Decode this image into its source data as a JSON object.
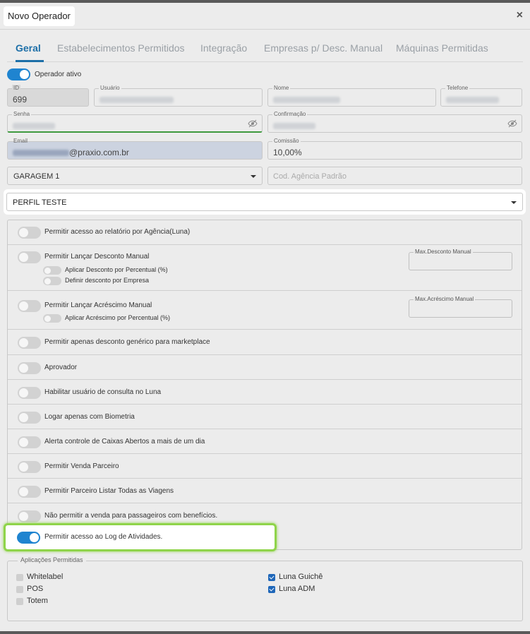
{
  "modal": {
    "title": "Novo Operador",
    "close_label": "×"
  },
  "tabs": [
    {
      "label": "Geral",
      "active": true
    },
    {
      "label": "Estabelecimentos Permitidos",
      "active": false
    },
    {
      "label": "Integração",
      "active": false
    },
    {
      "label": "Empresas p/ Desc. Manual",
      "active": false
    },
    {
      "label": "Máquinas Permitidas",
      "active": false
    }
  ],
  "operator_active": {
    "label": "Operador ativo",
    "on": true
  },
  "fields": {
    "id": {
      "label": "ID",
      "value": "699"
    },
    "usuario": {
      "label": "Usuário"
    },
    "nome": {
      "label": "Nome"
    },
    "telefone": {
      "label": "Telefone"
    },
    "senha": {
      "label": "Senha"
    },
    "confirmacao": {
      "label": "Confirmação"
    },
    "email": {
      "label": "Email",
      "value_visible": "@praxio.com.br"
    },
    "comissao": {
      "label": "Comissão",
      "value": "10,00%"
    },
    "garagem": {
      "value": "GARAGEM 1"
    },
    "cod_agencia": {
      "placeholder": "Cod. Agência Padrão"
    },
    "perfil": {
      "value": "PERFIL TESTE"
    }
  },
  "permissions": [
    {
      "label": "Permitir acesso ao relatório por Agência(Luna)",
      "on": false
    },
    {
      "label": "Permitir Lançar Desconto Manual",
      "on": false,
      "sub": [
        {
          "label": "Aplicar Desconto por Percentual (%)",
          "on": false
        },
        {
          "label": "Definir desconto por Empresa",
          "on": false
        }
      ],
      "max_label": "Max.Desconto Manual"
    },
    {
      "label": "Permitir Lançar Acréscimo Manual",
      "on": false,
      "sub": [
        {
          "label": "Aplicar Acréscimo por Percentual (%)",
          "on": false
        }
      ],
      "max_label": "Max.Acréscimo Manual"
    },
    {
      "label": "Permitir apenas desconto genérico para marketplace",
      "on": false
    },
    {
      "label": "Aprovador",
      "on": false
    },
    {
      "label": "Habilitar usuário de consulta no Luna",
      "on": false
    },
    {
      "label": "Logar apenas com Biometria",
      "on": false
    },
    {
      "label": "Alerta controle de Caixas Abertos a mais de um dia",
      "on": false
    },
    {
      "label": "Permitir Venda Parceiro",
      "on": false
    },
    {
      "label": "Permitir Parceiro Listar Todas as Viagens",
      "on": false
    },
    {
      "label": "Não permitir a venda para passageiros com benefícios.",
      "on": false
    },
    {
      "label": "Permitir acesso ao Log de Atividades.",
      "on": true
    }
  ],
  "applications": {
    "legend": "Aplicações Permitidas",
    "items": [
      {
        "label": "Whitelabel",
        "checked": false
      },
      {
        "label": "POS",
        "checked": false
      },
      {
        "label": "Totem",
        "checked": false
      },
      {
        "label": "Luna Guichê",
        "checked": true
      },
      {
        "label": "Luna ADM",
        "checked": true
      }
    ]
  },
  "colors": {
    "accent": "#1f84d0",
    "tab_active": "#1d6fa8",
    "highlight": "#8fd44a"
  }
}
